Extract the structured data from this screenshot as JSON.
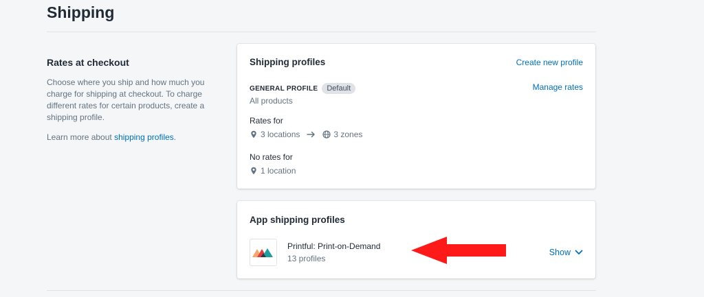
{
  "page": {
    "title": "Shipping"
  },
  "section": {
    "heading": "Rates at checkout",
    "description": "Choose where you ship and how much you charge for shipping at checkout. To charge different rates for certain products, create a shipping profile.",
    "learn_prefix": "Learn more about ",
    "learn_link": "shipping profiles",
    "learn_suffix": "."
  },
  "profiles_card": {
    "title": "Shipping profiles",
    "create_link": "Create new profile",
    "general_label": "GENERAL PROFILE",
    "default_badge": "Default",
    "products": "All products",
    "manage_link": "Manage rates",
    "rates_for_label": "Rates for",
    "rates_locations": "3 locations",
    "rates_zones": "3 zones",
    "no_rates_label": "No rates for",
    "no_rates_locations": "1 location"
  },
  "app_card": {
    "title": "App shipping profiles",
    "app_name": "Printful: Print-on-Demand",
    "app_profiles": "13 profiles",
    "show_label": "Show"
  },
  "colors": {
    "link": "#006fbb",
    "annotation_arrow": "#ff1a1a",
    "logo_colors": [
      "#f2a86b",
      "#e23b3b",
      "#1e9ea0",
      "#2a3a44"
    ]
  },
  "icons": [
    "location-pin-icon",
    "arrow-right-icon",
    "globe-icon",
    "chevron-down-icon",
    "printful-logo-icon"
  ]
}
